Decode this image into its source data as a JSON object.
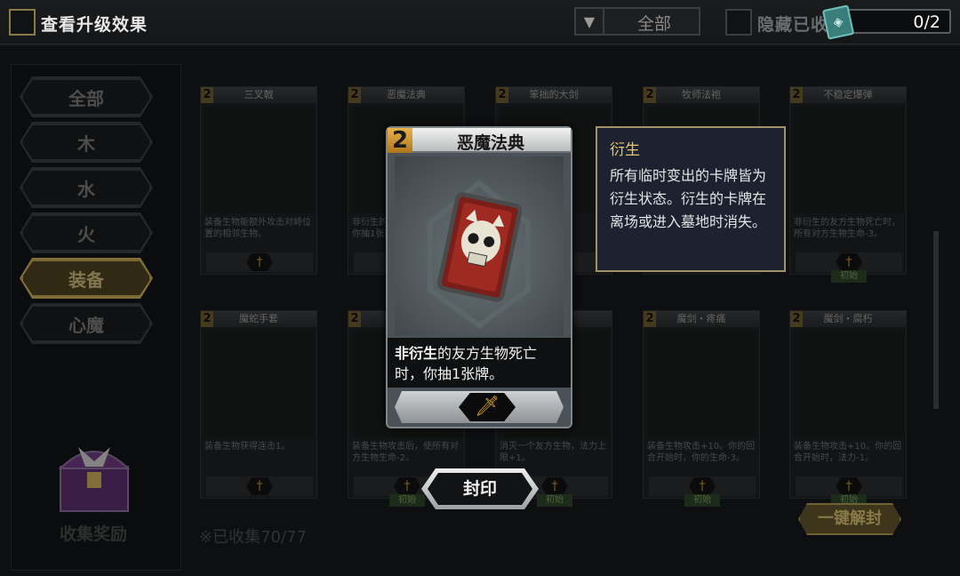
{
  "topbar": {
    "upgrade_label": "查看升级效果",
    "filter_value": "全部",
    "hide_label": "隐藏已收",
    "count": "0/2"
  },
  "sidebar": {
    "items": [
      {
        "label": "全部",
        "active": false
      },
      {
        "label": "木",
        "active": false
      },
      {
        "label": "水",
        "active": false
      },
      {
        "label": "火",
        "active": false
      },
      {
        "label": "装备",
        "active": true
      },
      {
        "label": "心魔",
        "active": false
      }
    ],
    "chest_label": "收集奖励",
    "collected": "※已收集70/77"
  },
  "cards": [
    {
      "cost": "2",
      "name": "三叉戟",
      "desc": "装备生物能额外攻击对峙位置的相邻生物。",
      "tag": ""
    },
    {
      "cost": "2",
      "name": "恶魔法典",
      "desc": "非衍生的友方生物死亡时，你抽1张牌。",
      "tag": ""
    },
    {
      "cost": "2",
      "name": "笨拙的大剑",
      "desc": "",
      "tag": ""
    },
    {
      "cost": "2",
      "name": "牧师法袍",
      "desc": "",
      "tag": ""
    },
    {
      "cost": "2",
      "name": "不稳定爆弹",
      "desc": "非衍生的友方生物死亡时，所有对方生物生命-3。",
      "tag": "初始"
    },
    {
      "cost": "2",
      "name": "魔蛇手套",
      "desc": "装备生物获得连击1。",
      "tag": ""
    },
    {
      "cost": "2",
      "name": "",
      "desc": "装备生物攻击后，使所有对方生物生命-2。",
      "tag": "初始"
    },
    {
      "cost": "2",
      "name": "",
      "desc": "消灭一个友方生物，法力上限+1。",
      "tag": "初始"
    },
    {
      "cost": "2",
      "name": "魔剑・疼痛",
      "desc": "装备生物攻击+10。你的回合开始时，你的生命-3。",
      "tag": "初始"
    },
    {
      "cost": "2",
      "name": "魔剑・腐朽",
      "desc": "装备生物攻击+10。你的回合开始时，法力-1。",
      "tag": "初始"
    }
  ],
  "modal": {
    "cost": "2",
    "title": "恶魔法典",
    "desc_bold": "非衍生",
    "desc_rest": "的友方生物死亡时，你抽1张牌。",
    "seal_label": "封印"
  },
  "tooltip": {
    "title": "衍生",
    "body": "所有临时变出的卡牌皆为衍生状态。衍生的卡牌在离场或进入墓地时消失。"
  },
  "unseal_all": "一键解封",
  "colors": {
    "accent_gold": "#c9a958",
    "cost_orange": "#e9b24a",
    "tooltip_border": "#a3916a"
  },
  "icons": [
    "checkbox-icon",
    "dropdown-arrow-icon",
    "gem-icon",
    "chest-icon",
    "dagger-icon",
    "skull-tome-icon"
  ]
}
